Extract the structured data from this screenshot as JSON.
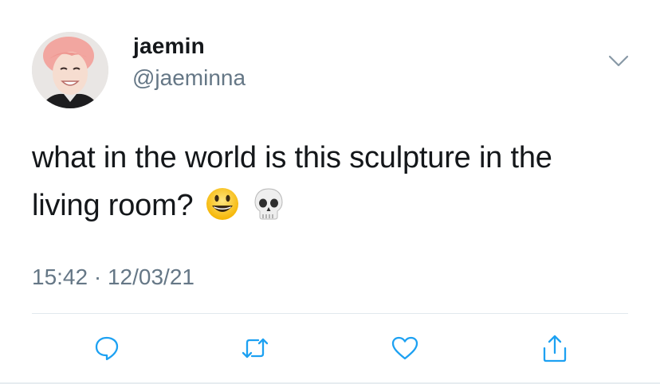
{
  "user": {
    "display_name": "jaemin",
    "handle": "@jaeminna",
    "avatar": "avatar-photo"
  },
  "tweet": {
    "text": "what in the world is this sculpture in the living room?",
    "emojis": [
      "grinning-face-emoji",
      "skull-emoji"
    ]
  },
  "meta": {
    "time": "15:42",
    "separator": "·",
    "date": "12/03/21"
  },
  "actions": [
    {
      "icon": "reply-icon"
    },
    {
      "icon": "retweet-icon"
    },
    {
      "icon": "like-icon"
    },
    {
      "icon": "share-icon"
    }
  ],
  "colors": {
    "text": "#14171a",
    "muted": "#657786",
    "action": "#1da1f2",
    "divider": "#e1e8ed"
  }
}
